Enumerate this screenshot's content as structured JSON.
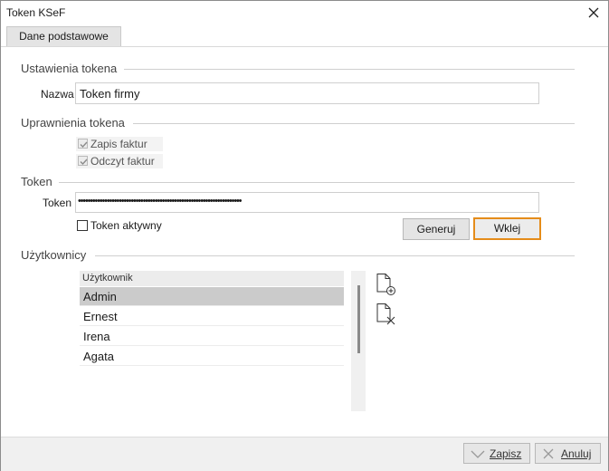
{
  "window": {
    "title": "Token KSeF"
  },
  "tabs": [
    {
      "label": "Dane podstawowe"
    }
  ],
  "settings": {
    "group_title": "Ustawienia tokena",
    "name_label": "Nazwa",
    "name_value": "Token firmy"
  },
  "permissions": {
    "group_title": "Uprawnienia tokena",
    "items": [
      {
        "label": "Zapis faktur",
        "checked": true
      },
      {
        "label": "Odczyt faktur",
        "checked": true
      }
    ]
  },
  "token": {
    "group_title": "Token",
    "token_label": "Token",
    "token_value": "••••••••••••••••••••••••••••••••••••••••••••••••••••••••••••••••••••",
    "active_label": "Token aktywny",
    "active_checked": false,
    "generate_label": "Generuj",
    "paste_label": "Wklej"
  },
  "users": {
    "group_title": "Użytkownicy",
    "column_header": "Użytkownik",
    "rows": [
      "Admin",
      "Ernest",
      "Irena",
      "Agata"
    ],
    "selected_index": 0
  },
  "footer": {
    "save_label": "Zapisz",
    "cancel_label": "Anuluj"
  },
  "colors": {
    "focus_border": "#e58c1a",
    "selected_row": "#cbcbcb"
  },
  "icons": {
    "close": "close-icon",
    "add_user": "add-document-icon",
    "remove_user": "remove-document-icon",
    "save": "checkmark-icon",
    "cancel": "cross-icon"
  }
}
